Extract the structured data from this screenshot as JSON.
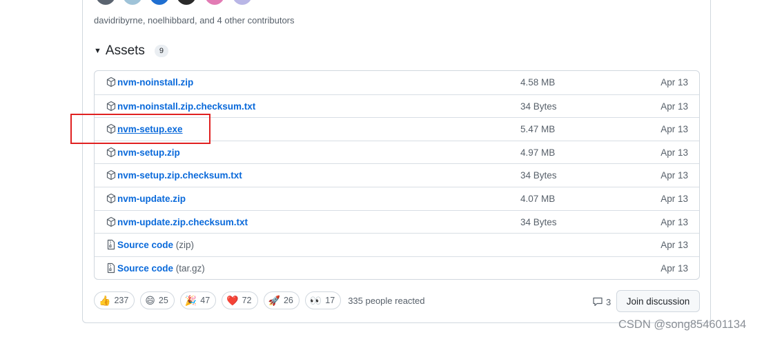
{
  "contributors": {
    "text": "davidribyrne, noelhibbard, and 4 other contributors",
    "avatars": [
      {
        "name": "avatar-1",
        "color": "#5b6470"
      },
      {
        "name": "avatar-2",
        "color": "#9fc3d8"
      },
      {
        "name": "avatar-3",
        "color": "#1f6fd1"
      },
      {
        "name": "avatar-4",
        "color": "#2a2a2a"
      },
      {
        "name": "avatar-5",
        "color": "#e27bb4"
      },
      {
        "name": "avatar-6",
        "color": "#b9b6e6"
      }
    ]
  },
  "assets": {
    "title": "Assets",
    "count": "9",
    "items": [
      {
        "name": "nvm-noinstall.zip",
        "sub": "",
        "size": "4.58 MB",
        "date": "Apr 13",
        "icon": "package-icon"
      },
      {
        "name": "nvm-noinstall.zip.checksum.txt",
        "sub": "",
        "size": "34 Bytes",
        "date": "Apr 13",
        "icon": "package-icon"
      },
      {
        "name": "nvm-setup.exe",
        "sub": "",
        "size": "5.47 MB",
        "date": "Apr 13",
        "icon": "package-icon"
      },
      {
        "name": "nvm-setup.zip",
        "sub": "",
        "size": "4.97 MB",
        "date": "Apr 13",
        "icon": "package-icon"
      },
      {
        "name": "nvm-setup.zip.checksum.txt",
        "sub": "",
        "size": "34 Bytes",
        "date": "Apr 13",
        "icon": "package-icon"
      },
      {
        "name": "nvm-update.zip",
        "sub": "",
        "size": "4.07 MB",
        "date": "Apr 13",
        "icon": "package-icon"
      },
      {
        "name": "nvm-update.zip.checksum.txt",
        "sub": "",
        "size": "34 Bytes",
        "date": "Apr 13",
        "icon": "package-icon"
      },
      {
        "name": "Source code",
        "sub": "(zip)",
        "size": "",
        "date": "Apr 13",
        "icon": "file-zip-icon"
      },
      {
        "name": "Source code",
        "sub": "(tar.gz)",
        "size": "",
        "date": "Apr 13",
        "icon": "file-zip-icon"
      }
    ]
  },
  "reactions": {
    "items": [
      {
        "emoji": "👍",
        "count": "237"
      },
      {
        "emoji": "😄",
        "count": "25"
      },
      {
        "emoji": "🎉",
        "count": "47"
      },
      {
        "emoji": "❤️",
        "count": "72"
      },
      {
        "emoji": "🚀",
        "count": "26"
      },
      {
        "emoji": "👀",
        "count": "17"
      }
    ],
    "summary": "335 people reacted"
  },
  "discussion": {
    "comment_count": "3",
    "join_label": "Join discussion"
  },
  "watermark": "CSDN @song854601134",
  "colors": {
    "link": "#0969da",
    "muted": "#57606a",
    "highlight_box": "#e02020"
  }
}
